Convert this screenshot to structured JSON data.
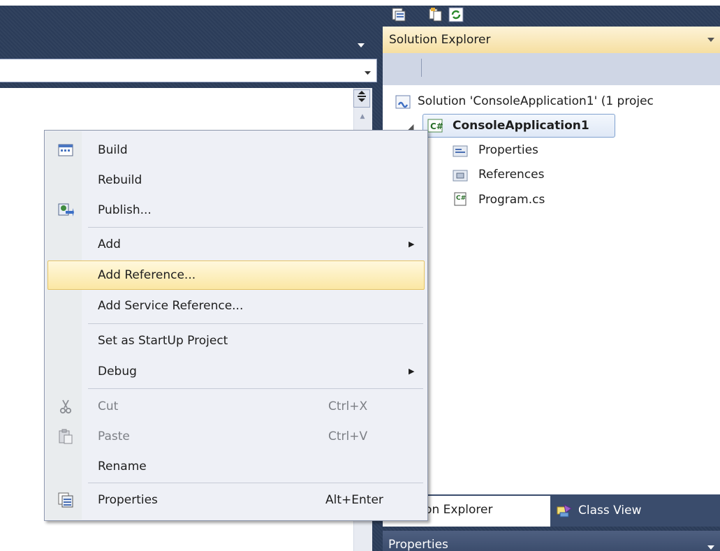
{
  "solution_explorer": {
    "title": "Solution Explorer",
    "tree": {
      "solution": "Solution 'ConsoleApplication1' (1 projec",
      "project": "ConsoleApplication1",
      "items": [
        "Properties",
        "References",
        "Program.cs"
      ]
    },
    "tabs": {
      "solution_explorer": "Solution Explorer",
      "class_view": "Class View"
    },
    "properties_title": "Properties"
  },
  "context_menu": {
    "build": "Build",
    "rebuild": "Rebuild",
    "publish": "Publish...",
    "add": "Add",
    "add_reference": "Add Reference...",
    "add_service_reference": "Add Service Reference...",
    "set_startup": "Set as StartUp Project",
    "debug": "Debug",
    "cut": "Cut",
    "cut_shortcut": "Ctrl+X",
    "paste": "Paste",
    "paste_shortcut": "Ctrl+V",
    "rename": "Rename",
    "properties": "Properties",
    "properties_shortcut": "Alt+Enter"
  },
  "colors": {
    "ide_background": "#2b3c59",
    "hover_highlight": "#fbe7a4",
    "selection_border": "#7fa1cf"
  }
}
